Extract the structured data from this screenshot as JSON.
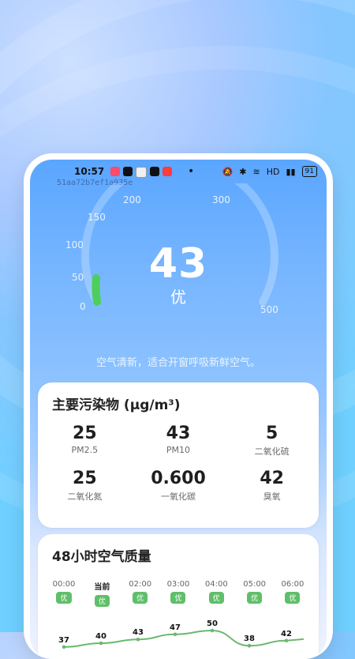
{
  "status_bar": {
    "time": "10:57",
    "network": "HD",
    "battery": "91",
    "icons": [
      "music-app-icon",
      "tiktok-icon",
      "message-icon",
      "tiktok-icon",
      "red-app-icon"
    ]
  },
  "device_id": "51aa72b7ef1a935e",
  "gauge": {
    "scale_labels": [
      "0",
      "50",
      "100",
      "150",
      "200",
      "300",
      "500"
    ],
    "value": "43",
    "level": "优"
  },
  "advice": "空气清新，适合开窗呼吸新鲜空气。",
  "pollutants": {
    "title": "主要污染物 (μg/m³)",
    "items": [
      {
        "value": "25",
        "label": "PM2.5"
      },
      {
        "value": "43",
        "label": "PM10"
      },
      {
        "value": "5",
        "label": "二氧化硫"
      },
      {
        "value": "25",
        "label": "二氧化氮"
      },
      {
        "value": "0.600",
        "label": "一氧化碳"
      },
      {
        "value": "42",
        "label": "臭氧"
      }
    ]
  },
  "aq48": {
    "title": "48小时空气质量",
    "hours": [
      {
        "time": "00:00",
        "level": "优"
      },
      {
        "time": "当前",
        "level": "优"
      },
      {
        "time": "02:00",
        "level": "优"
      },
      {
        "time": "03:00",
        "level": "优"
      },
      {
        "time": "04:00",
        "level": "优"
      },
      {
        "time": "05:00",
        "level": "优"
      },
      {
        "time": "06:00",
        "level": "优"
      }
    ]
  },
  "chart_data": {
    "type": "line",
    "x": [
      "00:00",
      "当前",
      "02:00",
      "03:00",
      "04:00",
      "05:00",
      "06:00"
    ],
    "series": [
      {
        "values": [
          37,
          40,
          43,
          47,
          50,
          38,
          42
        ]
      }
    ]
  },
  "colors": {
    "good": "#5fbf69",
    "accent": "#5aa6ff"
  }
}
